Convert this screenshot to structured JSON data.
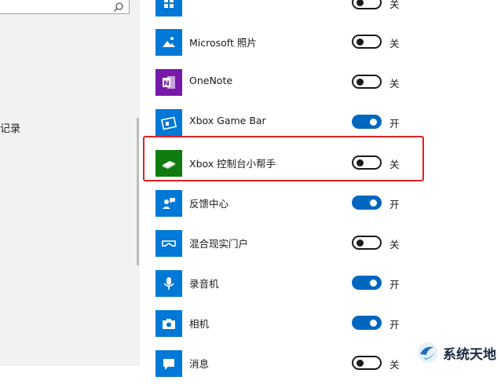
{
  "left_pane": {
    "partial_label": "记录"
  },
  "apps": [
    {
      "name": "",
      "state": "关",
      "on": false,
      "tile_color": "#0078d7",
      "icon": "app-tile-icon"
    },
    {
      "name": "Microsoft 照片",
      "state": "关",
      "on": false,
      "tile_color": "#0078d7",
      "icon": "photos-icon"
    },
    {
      "name": "OneNote",
      "state": "关",
      "on": false,
      "tile_color": "#7719aa",
      "icon": "onenote-icon"
    },
    {
      "name": "Xbox Game Bar",
      "state": "开",
      "on": true,
      "tile_color": "#0078d7",
      "icon": "game-bar-icon"
    },
    {
      "name": "Xbox 控制台小帮手",
      "state": "关",
      "on": false,
      "tile_color": "#107c10",
      "icon": "xbox-console-icon"
    },
    {
      "name": "反馈中心",
      "state": "开",
      "on": true,
      "tile_color": "#0078d7",
      "icon": "feedback-hub-icon"
    },
    {
      "name": "混合现实门户",
      "state": "关",
      "on": false,
      "tile_color": "#0078d7",
      "icon": "mixed-reality-icon"
    },
    {
      "name": "录音机",
      "state": "开",
      "on": true,
      "tile_color": "#0078d7",
      "icon": "voice-recorder-icon"
    },
    {
      "name": "相机",
      "state": "开",
      "on": true,
      "tile_color": "#0078d7",
      "icon": "camera-icon"
    },
    {
      "name": "消息",
      "state": "关",
      "on": false,
      "tile_color": "#0078d7",
      "icon": "messaging-icon"
    }
  ],
  "watermark": {
    "text": "系统天地"
  },
  "colors": {
    "accent": "#0067c0",
    "highlight": "#e02020"
  }
}
